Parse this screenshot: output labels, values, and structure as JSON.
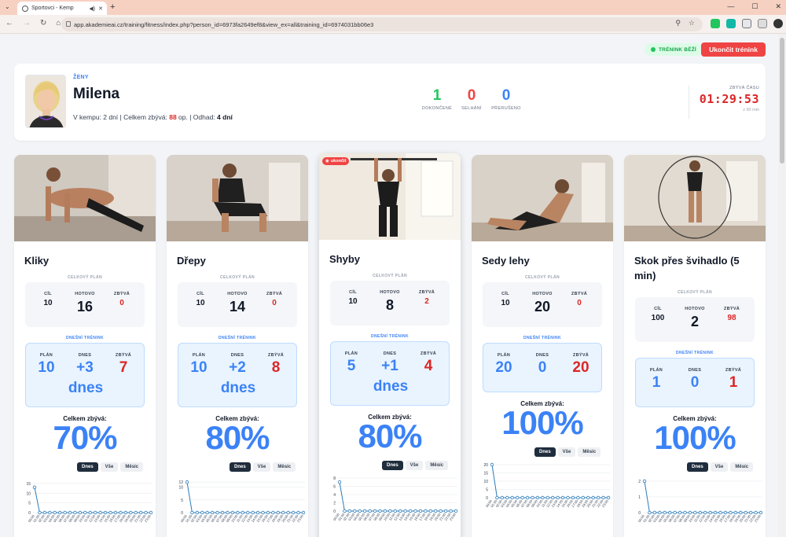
{
  "browser": {
    "tab_title": "Sportovci - Kemp",
    "url": "app.akademieai.cz/training/fitness/index.php?person_id=6973fa2649ef8&view_ex=all&training_id=6974031bb06e3"
  },
  "header": {
    "status": "TRÉNINK BĚŽÍ",
    "end_button": "Ukončit trénink"
  },
  "profile": {
    "group": "ŽENY",
    "name": "Milena",
    "info_prefix": "V kempu: 2 dní | Celkem zbývá: ",
    "remaining_ops": "88",
    "info_middle": " op. | Odhad: ",
    "estimate": "4 dní",
    "stats": [
      {
        "value": "1",
        "label": "DOKONČENÉ",
        "color": "#22c55e"
      },
      {
        "value": "0",
        "label": "SELHÁNÍ",
        "color": "#ef4444"
      },
      {
        "value": "0",
        "label": "PŘERUŠENO",
        "color": "#3b82f6"
      }
    ],
    "timer_label": "ZBÝVÁ ČASU",
    "timer": "01:29:53",
    "timer_sub": "z 90 min"
  },
  "labels": {
    "overall_plan": "CELKOVÝ PLÁN",
    "cil": "CÍL",
    "hotovo": "HOTOVO",
    "zbyva": "ZBÝVÁ",
    "today_training": "DNEŠNÍ TRÉNINK",
    "plan": "PLÁN",
    "dnes": "DNES",
    "remaining_total": "Celkem zbývá:",
    "tab_today": "Dnes",
    "tab_all": "Vše",
    "tab_month": "Měsíc",
    "badge": "ukončit"
  },
  "exercises": [
    {
      "title": "Kliky",
      "cil": "10",
      "hotovo": "16",
      "zbyva": "0",
      "plan": "10",
      "dnes": "+3",
      "dnes_unit": "dnes",
      "today_zbyva": "7",
      "percent": "70%",
      "chart_yticks": [
        "15",
        "10",
        "5",
        "0"
      ],
      "chart_ymax": 17,
      "chart_first": 13
    },
    {
      "title": "Dřepy",
      "cil": "10",
      "hotovo": "14",
      "zbyva": "0",
      "plan": "10",
      "dnes": "+2",
      "dnes_unit": "dnes",
      "today_zbyva": "8",
      "percent": "80%",
      "chart_yticks": [
        "12",
        "10",
        "5",
        "0"
      ],
      "chart_ymax": 13,
      "chart_first": 12
    },
    {
      "title": "Shyby",
      "cil": "10",
      "hotovo": "8",
      "zbyva": "2",
      "plan": "5",
      "dnes": "+1",
      "dnes_unit": "dnes",
      "today_zbyva": "4",
      "percent": "80%",
      "chart_yticks": [
        "8",
        "6",
        "4",
        "2",
        "0"
      ],
      "chart_ymax": 8,
      "chart_first": 7
    },
    {
      "title": "Sedy lehy",
      "cil": "10",
      "hotovo": "20",
      "zbyva": "0",
      "plan": "20",
      "dnes": "0",
      "dnes_unit": "",
      "today_zbyva": "20",
      "percent": "100%",
      "chart_yticks": [
        "20",
        "15",
        "10",
        "5",
        "0"
      ],
      "chart_ymax": 20,
      "chart_first": 20
    },
    {
      "title": "Skok přes švihadlo (5 min)",
      "cil": "100",
      "hotovo": "2",
      "zbyva": "98",
      "plan": "1",
      "dnes": "0",
      "dnes_unit": "",
      "today_zbyva": "1",
      "percent": "100%",
      "chart_yticks": [
        "2",
        "1",
        "0"
      ],
      "chart_ymax": 2.1,
      "chart_first": 2
    }
  ],
  "chart_xticks": [
    "00:00",
    "01:00",
    "02:00",
    "03:00",
    "04:00",
    "05:00",
    "06:00",
    "07:00",
    "08:00",
    "09:00",
    "10:00",
    "11:00",
    "12:00",
    "13:00",
    "14:00",
    "15:00",
    "16:00",
    "17:00",
    "18:00",
    "19:00",
    "20:00",
    "21:00",
    "22:00",
    "23:00"
  ]
}
